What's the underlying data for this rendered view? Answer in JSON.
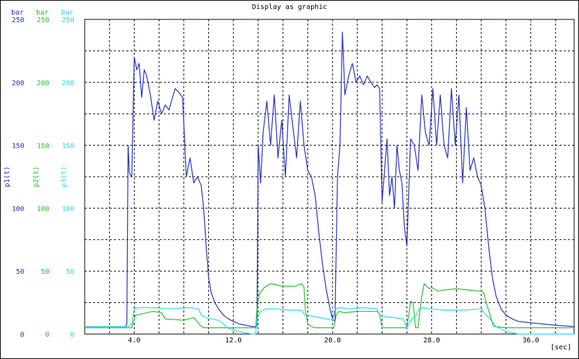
{
  "chart_data": {
    "type": "line",
    "title": "Display as graphic",
    "xlabel": "[sec]",
    "xlim": [
      0,
      39.5
    ],
    "xticks": [
      "4.0",
      "12.0",
      "20.0",
      "28.0",
      "36.0"
    ],
    "xtick_values": [
      4,
      12,
      20,
      28,
      36
    ],
    "x_grid_step": 2,
    "ylim": [
      0,
      250
    ],
    "ytick_values": [
      0,
      50,
      100,
      150,
      200,
      250
    ],
    "y_grid_step": 25,
    "grid": true,
    "axes": [
      {
        "series": "p1(t)",
        "unit": "bar",
        "ticks": [
          "0",
          "50",
          "100",
          "150",
          "200",
          "250"
        ],
        "color": "#1f2fb8"
      },
      {
        "series": "p2(t)",
        "unit": "bar",
        "ticks": [
          "0",
          "50",
          "100",
          "150",
          "200",
          "250"
        ],
        "color": "#22c022"
      },
      {
        "series": "p3(t)",
        "unit": "bar",
        "ticks": [
          "0",
          "50",
          "100",
          "150",
          "200",
          "250"
        ],
        "color": "#22d8e8"
      }
    ],
    "series": [
      {
        "name": "p1(t)",
        "color": "#1f2fb8",
        "x": [
          0,
          3.3,
          3.4,
          3.5,
          3.6,
          3.8,
          4.0,
          4.2,
          4.4,
          4.6,
          4.8,
          5.0,
          5.3,
          5.6,
          5.9,
          6.2,
          6.5,
          6.8,
          7.0,
          7.3,
          7.6,
          7.9,
          8.2,
          8.5,
          8.8,
          9.1,
          9.4,
          9.6,
          9.8,
          10.0,
          10.2,
          10.5,
          10.8,
          11.2,
          11.6,
          12.0,
          12.5,
          13.0,
          13.5,
          13.9,
          14.0,
          14.2,
          14.4,
          14.7,
          15.0,
          15.3,
          15.6,
          15.9,
          16.2,
          16.5,
          16.8,
          17.1,
          17.4,
          17.7,
          18.0,
          18.3,
          18.6,
          18.9,
          19.2,
          19.5,
          19.8,
          20.0,
          20.2,
          20.4,
          20.6,
          20.8,
          21.0,
          21.3,
          21.6,
          21.9,
          22.2,
          22.5,
          22.8,
          23.1,
          23.4,
          23.6,
          23.8,
          24.0,
          24.2,
          24.4,
          24.6,
          24.8,
          25.0,
          25.2,
          25.4,
          25.6,
          25.8,
          26.0,
          26.3,
          26.6,
          26.9,
          27.2,
          27.5,
          27.8,
          28.1,
          28.4,
          28.7,
          29.0,
          29.3,
          29.6,
          29.9,
          30.2,
          30.5,
          30.8,
          31.1,
          31.4,
          31.7,
          32.0,
          32.3,
          32.6,
          32.9,
          33.2,
          33.6,
          34.0,
          34.5,
          35.0,
          36.0,
          37.0,
          38.0,
          39.5
        ],
        "values": [
          6,
          6,
          8,
          150,
          128,
          125,
          220,
          210,
          215,
          188,
          210,
          205,
          190,
          170,
          185,
          175,
          182,
          178,
          185,
          195,
          192,
          188,
          125,
          140,
          120,
          125,
          118,
          100,
          70,
          45,
          33,
          25,
          20,
          15,
          12,
          10,
          8,
          7,
          6,
          6,
          150,
          120,
          160,
          185,
          150,
          190,
          140,
          170,
          125,
          190,
          165,
          140,
          185,
          150,
          130,
          125,
          110,
          80,
          55,
          35,
          20,
          12,
          10,
          125,
          150,
          240,
          190,
          205,
          215,
          200,
          205,
          198,
          205,
          200,
          196,
          198,
          195,
          105,
          130,
          155,
          110,
          125,
          100,
          150,
          130,
          120,
          85,
          70,
          155,
          150,
          130,
          190,
          160,
          150,
          195,
          150,
          190,
          150,
          140,
          195,
          150,
          190,
          120,
          180,
          130,
          140,
          125,
          118,
          100,
          70,
          45,
          30,
          20,
          15,
          12,
          10,
          9,
          8,
          7,
          6
        ]
      },
      {
        "name": "p2(t)",
        "color": "#22c022",
        "x": [
          0,
          3.5,
          3.8,
          4.1,
          5.5,
          6.2,
          6.5,
          8.0,
          8.4,
          8.8,
          9.0,
          9.3,
          9.6,
          10.0,
          11.0,
          12.0,
          13.5,
          13.8,
          13.9,
          14.1,
          14.5,
          15.0,
          16.0,
          17.0,
          17.5,
          17.7,
          17.8,
          18.0,
          18.5,
          19.0,
          20.0,
          20.1,
          20.3,
          20.5,
          21.0,
          22.0,
          23.0,
          23.6,
          23.8,
          24.0,
          25.0,
          26.0,
          26.3,
          26.5,
          26.7,
          26.9,
          27.2,
          27.4,
          27.6,
          27.8,
          28.0,
          28.5,
          29.0,
          30.0,
          31.0,
          32.0,
          32.2,
          32.4,
          33.0,
          34.0,
          35.0,
          36.0,
          37.0,
          38.0,
          39.5
        ],
        "values": [
          5,
          5,
          5,
          15,
          18,
          17,
          12,
          11,
          12,
          13,
          11,
          7,
          5,
          5,
          5,
          5,
          5,
          5,
          20,
          32,
          37,
          40,
          38,
          38,
          40,
          37,
          20,
          8,
          5,
          5,
          5,
          5,
          15,
          18,
          17,
          18,
          18,
          18,
          16,
          5,
          5,
          5,
          26,
          25,
          5,
          5,
          30,
          40,
          38,
          36,
          37,
          34,
          35,
          36,
          35,
          34,
          33,
          25,
          6,
          5,
          5,
          5,
          5,
          5,
          5
        ]
      },
      {
        "name": "p3(t)",
        "color": "#22d8e8",
        "x": [
          0,
          3.5,
          3.8,
          4.0,
          4.3,
          5.5,
          7.0,
          8.5,
          9.2,
          9.4,
          9.6,
          10.0,
          10.4,
          11.0,
          11.5,
          12.0,
          12.5,
          13.0,
          13.5,
          13.8,
          13.9,
          14.2,
          14.6,
          15.5,
          16.5,
          17.5,
          17.7,
          18.0,
          18.5,
          19.0,
          19.5,
          20.0,
          20.2,
          20.6,
          21.5,
          22.5,
          23.6,
          23.8,
          24.2,
          25.0,
          25.7,
          26.0,
          26.4,
          26.7,
          27.0,
          27.3,
          27.8,
          29.0,
          30.5,
          32.0,
          32.3,
          32.7,
          33.2,
          34.0,
          35.0,
          36.0,
          37.0,
          38.0,
          39.5
        ],
        "values": [
          6,
          6,
          8,
          20,
          21,
          21,
          20,
          21,
          20,
          15,
          14,
          12,
          12,
          10,
          5,
          3,
          2,
          1,
          0,
          0,
          12,
          18,
          20,
          20,
          19,
          19,
          16,
          15,
          14,
          13,
          12,
          11,
          20,
          21,
          20,
          21,
          20,
          15,
          14,
          13,
          12,
          5,
          12,
          14,
          20,
          21,
          20,
          19,
          19,
          20,
          16,
          12,
          6,
          2,
          0,
          0,
          0,
          0,
          0
        ]
      }
    ]
  }
}
